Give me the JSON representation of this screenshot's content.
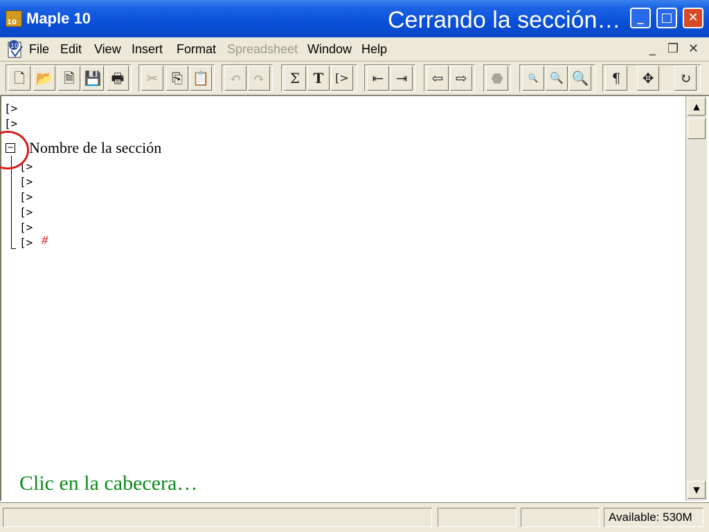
{
  "window": {
    "app_title": "Maple 10",
    "logo_badge": "10",
    "overlay_title": "Cerrando la sección…",
    "min_glyph": "_",
    "max_glyph": "□",
    "close_glyph": "✕"
  },
  "menu": {
    "items": [
      "File",
      "Edit",
      "View",
      "Insert",
      "Format",
      "Spreadsheet",
      "Window",
      "Help"
    ],
    "mdi_min": "_",
    "mdi_restore": "❐",
    "mdi_close": "✕"
  },
  "toolbar": {
    "buttons": [
      {
        "icon": "new-document-icon",
        "glyph": "🗋"
      },
      {
        "icon": "open-folder-icon",
        "glyph": "📂"
      },
      {
        "icon": "open-url-icon",
        "glyph": "🗎"
      },
      {
        "icon": "save-icon",
        "glyph": "💾"
      },
      {
        "icon": "print-icon",
        "glyph": "🖶"
      },
      {
        "icon": "cut-icon",
        "glyph": "✂"
      },
      {
        "icon": "copy-icon",
        "glyph": "⎘"
      },
      {
        "icon": "paste-icon",
        "glyph": "📋"
      },
      {
        "icon": "undo-icon",
        "glyph": "↶"
      },
      {
        "icon": "redo-icon",
        "glyph": "↷"
      },
      {
        "icon": "sigma-icon",
        "glyph": "Σ"
      },
      {
        "icon": "text-icon",
        "glyph": "T"
      },
      {
        "icon": "prompt-icon",
        "glyph": "[>"
      },
      {
        "icon": "outdent-icon",
        "glyph": "⇤"
      },
      {
        "icon": "indent-icon",
        "glyph": "⇥"
      },
      {
        "icon": "back-arrow-icon",
        "glyph": "⇦"
      },
      {
        "icon": "forward-arrow-icon",
        "glyph": "⇨"
      },
      {
        "icon": "stop-icon",
        "glyph": "⬣"
      },
      {
        "icon": "zoom-100-icon",
        "glyph": "🔍"
      },
      {
        "icon": "zoom-150-icon",
        "glyph": "🔍"
      },
      {
        "icon": "zoom-200-icon",
        "glyph": "🔍"
      },
      {
        "icon": "pilcrow-icon",
        "glyph": "¶"
      },
      {
        "icon": "move-icon",
        "glyph": "✥"
      },
      {
        "icon": "restart-icon",
        "glyph": "↻"
      }
    ]
  },
  "worksheet": {
    "prompt_bracket": "[",
    "prompt_symbol": ">",
    "collapse_glyph": "−",
    "section_title": "Nombre de la sección",
    "hash": "#",
    "caption": "Clic en la cabecera…"
  },
  "scrollbar": {
    "up_glyph": "▲",
    "down_glyph": "▼"
  },
  "status": {
    "available": "Available: 530M"
  }
}
